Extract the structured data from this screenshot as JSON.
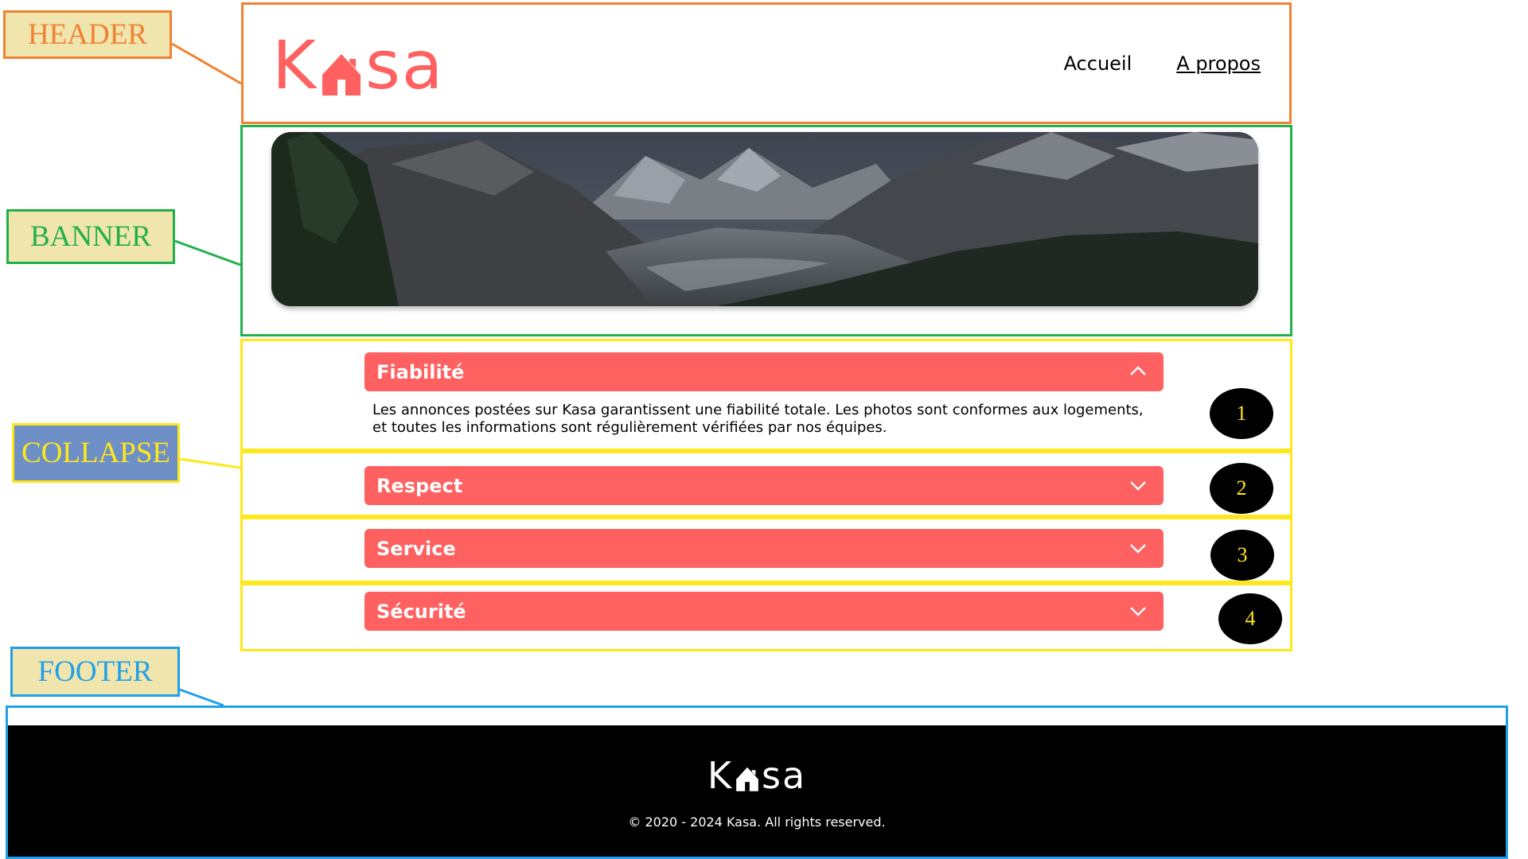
{
  "annotations": {
    "header": "HEADER",
    "banner": "BANNER",
    "collapse": "COLLAPSE",
    "footer": "FOOTER"
  },
  "header": {
    "logo_left": "K",
    "logo_right": "sa",
    "nav": [
      {
        "label": "Accueil"
      },
      {
        "label": "A propos"
      }
    ]
  },
  "collapses": [
    {
      "number": "1",
      "title": "Fiabilité",
      "open": true,
      "content": "Les annonces postées sur Kasa garantissent une fiabilité totale. Les photos sont conformes aux logements, et toutes les informations sont régulièrement vérifiées par nos équipes."
    },
    {
      "number": "2",
      "title": "Respect",
      "open": false
    },
    {
      "number": "3",
      "title": "Service",
      "open": false
    },
    {
      "number": "4",
      "title": "Sécurité",
      "open": false
    }
  ],
  "footer": {
    "logo_left": "K",
    "logo_right": "sa",
    "copyright": "© 2020 - 2024 Kasa. All rights reserved."
  },
  "colors": {
    "brand": "#ff6060",
    "header_annotation": "#f08232",
    "banner_annotation": "#22b04c",
    "collapse_annotation": "#ffe81a",
    "footer_annotation": "#1fa0e8"
  }
}
